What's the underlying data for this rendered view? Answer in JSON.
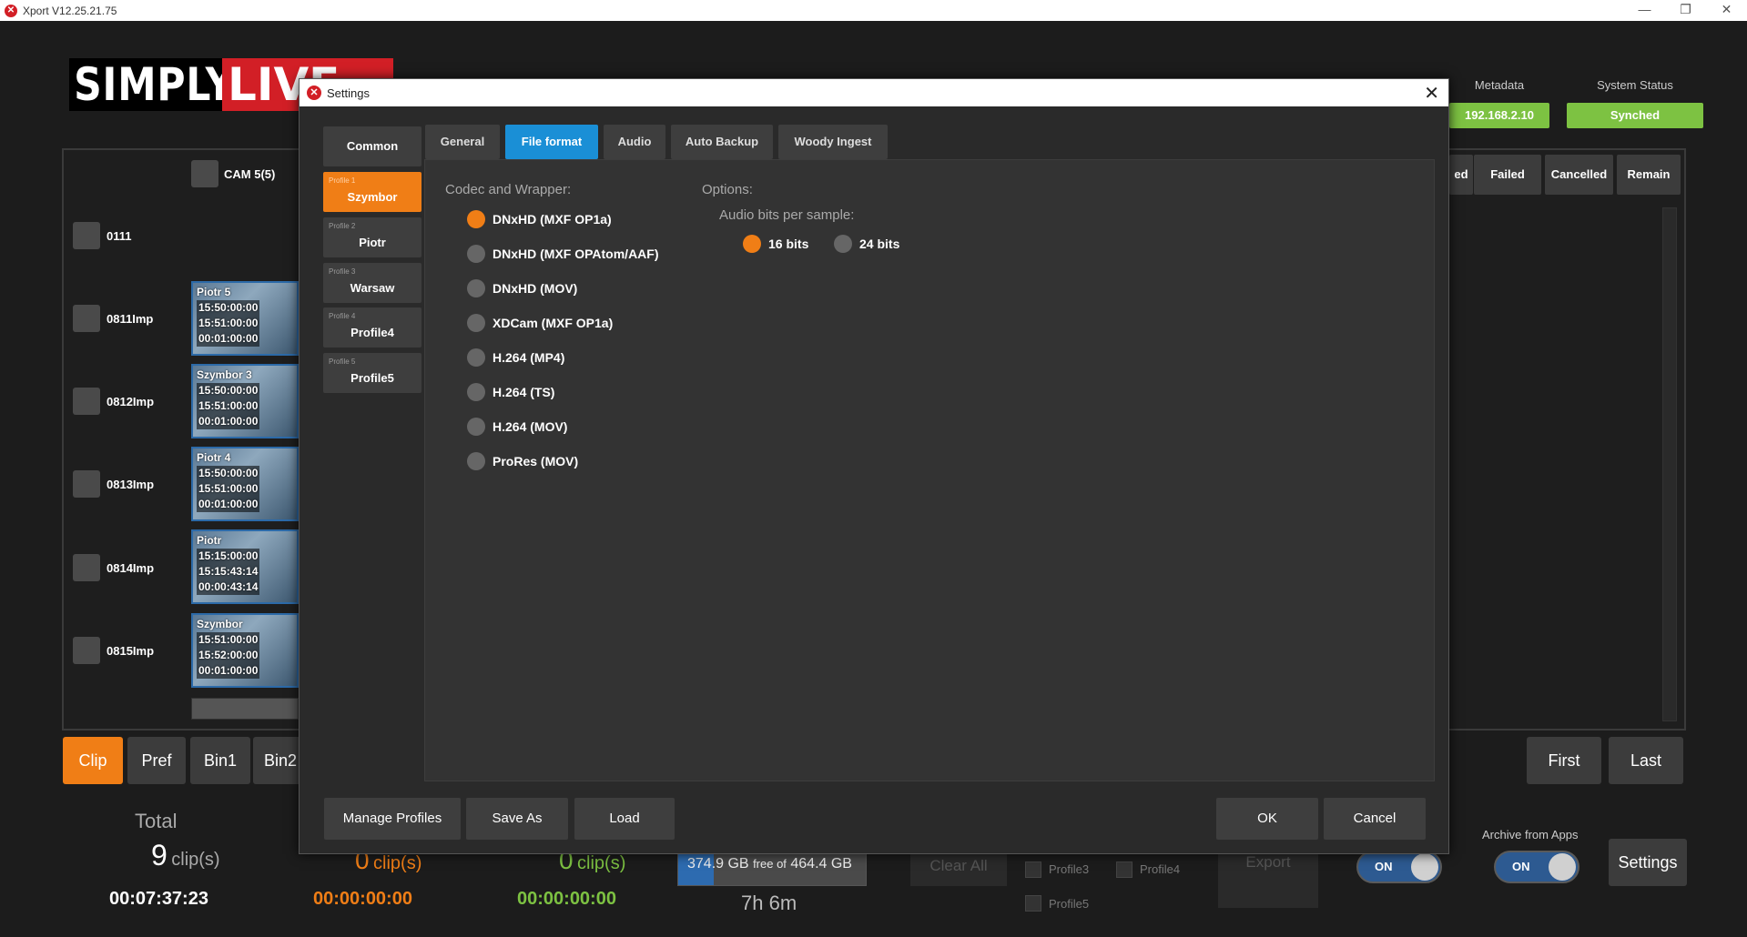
{
  "window": {
    "title": "Xport V12.25.21.75",
    "minimize": "—",
    "maximize": "❐",
    "close": "✕"
  },
  "brand": {
    "part1": "SIMPLY",
    "part2": "LIVE"
  },
  "left": {
    "cam_label": "CAM 5(5)",
    "rows": [
      "0111",
      "0811Imp",
      "0812Imp",
      "0813Imp",
      "0814Imp",
      "0815Imp"
    ],
    "clips": [
      {
        "name": "Piotr 5",
        "tc_in": "15:50:00:00",
        "tc_out": "15:51:00:00",
        "dur": "00:01:00:00"
      },
      {
        "name": "Szymbor 3",
        "tc_in": "15:50:00:00",
        "tc_out": "15:51:00:00",
        "dur": "00:01:00:00"
      },
      {
        "name": "Piotr 4",
        "tc_in": "15:50:00:00",
        "tc_out": "15:51:00:00",
        "dur": "00:01:00:00"
      },
      {
        "name": "Piotr",
        "tc_in": "15:15:00:00",
        "tc_out": "15:15:43:14",
        "dur": "00:00:43:14"
      },
      {
        "name": "Szymbor",
        "tc_in": "15:51:00:00",
        "tc_out": "15:52:00:00",
        "dur": "00:01:00:00"
      }
    ],
    "tabs": [
      "Clip",
      "Pref",
      "Bin1",
      "Bin2"
    ]
  },
  "right": {
    "metadata_label": "Metadata",
    "ip": "192.168.2.10",
    "system_status_label": "System Status",
    "status": "Synched",
    "headers": [
      "ed",
      "Failed",
      "Cancelled",
      "Remain"
    ],
    "first": "First",
    "last": "Last",
    "archive_label": "Archive from Apps",
    "settings": "Settings"
  },
  "bottom": {
    "total_label": "Total",
    "total_count": "9",
    "total_unit": "clip(s)",
    "total_time": "00:07:37:23",
    "c2_count": "0",
    "c2_unit": "clip(s)",
    "c2_time": "00:00:00:00",
    "c3_count": "0",
    "c3_unit": "clip(s)",
    "c3_time": "00:00:00:00",
    "disk_free": "374.9 GB",
    "disk_free_of": "free of",
    "disk_total": "464.4 GB",
    "disk_used_fraction": 0.19,
    "remaining_time": "7h 6m",
    "clear_all": "Clear All",
    "profile3": "Profile3",
    "profile4": "Profile4",
    "profile5": "Profile5",
    "export": "Export",
    "toggle_on": "ON",
    "toggle2_on": "ON"
  },
  "dialog": {
    "title": "Settings",
    "close": "✕",
    "common": "Common",
    "profiles": [
      {
        "num": "Profile 1",
        "name": "Szymbor",
        "active": true
      },
      {
        "num": "Profile 2",
        "name": "Piotr",
        "active": false
      },
      {
        "num": "Profile 3",
        "name": "Warsaw",
        "active": false
      },
      {
        "num": "Profile 4",
        "name": "Profile4",
        "active": false
      },
      {
        "num": "Profile 5",
        "name": "Profile5",
        "active": false
      }
    ],
    "tabs": [
      "General",
      "File format",
      "Audio",
      "Auto Backup",
      "Woody Ingest"
    ],
    "active_tab": "File format",
    "codec_title": "Codec and Wrapper:",
    "codecs": [
      "DNxHD (MXF OP1a)",
      "DNxHD (MXF OPAtom/AAF)",
      "DNxHD (MOV)",
      "XDCam (MXF OP1a)",
      "H.264 (MP4)",
      "H.264 (TS)",
      "H.264 (MOV)",
      "ProRes (MOV)"
    ],
    "codec_selected": "DNxHD (MXF OP1a)",
    "options_title": "Options:",
    "audio_bits_title": "Audio bits per sample:",
    "bits_16": "16 bits",
    "bits_24": "24 bits",
    "bits_selected": "16 bits",
    "manage_profiles": "Manage Profiles",
    "save_as": "Save As",
    "load": "Load",
    "ok": "OK",
    "cancel": "Cancel"
  },
  "colors": {
    "accent": "#f07e16",
    "active_tab": "#1a8fd6",
    "brand_red": "#d21f26",
    "status_green": "#7dc242"
  }
}
